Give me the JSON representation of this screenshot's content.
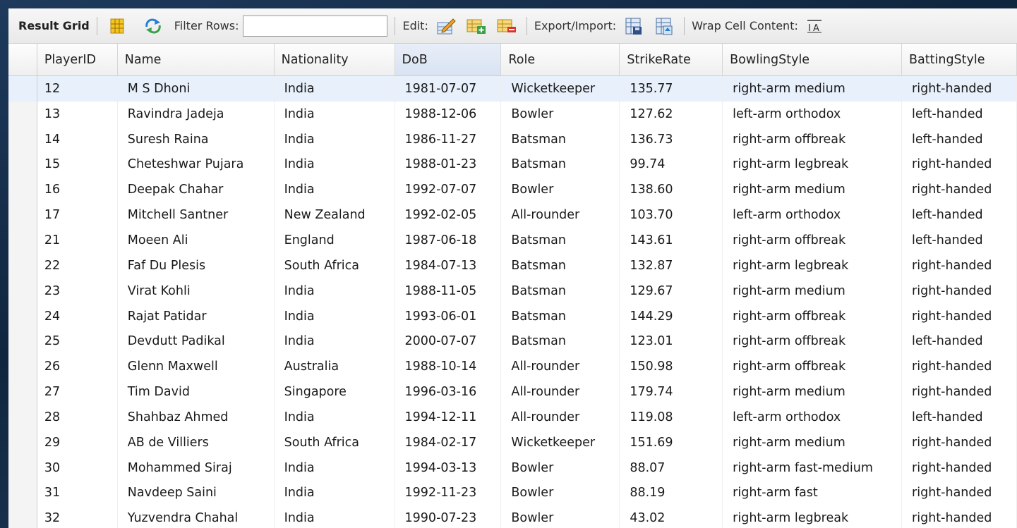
{
  "toolbar": {
    "title": "Result Grid",
    "filter_label": "Filter Rows:",
    "filter_value": "",
    "edit_label": "Edit:",
    "export_label": "Export/Import:",
    "wrap_label": "Wrap Cell Content:",
    "icons": [
      "grid-layout-icon",
      "refresh-icon",
      "edit-row-icon",
      "add-row-icon",
      "delete-row-icon",
      "export-icon",
      "import-icon",
      "wrap-text-icon"
    ]
  },
  "table": {
    "columns": [
      "PlayerID",
      "Name",
      "Nationality",
      "DoB",
      "Role",
      "StrikeRate",
      "BowlingStyle",
      "BattingStyle"
    ],
    "sorted_column": "DoB",
    "rows": [
      [
        "12",
        "M S Dhoni",
        "India",
        "1981-07-07",
        "Wicketkeeper",
        "135.77",
        "right-arm medium",
        "right-handed"
      ],
      [
        "13",
        "Ravindra Jadeja",
        "India",
        "1988-12-06",
        "Bowler",
        "127.62",
        "left-arm orthodox",
        "left-handed"
      ],
      [
        "14",
        "Suresh Raina",
        "India",
        "1986-11-27",
        "Batsman",
        "136.73",
        "right-arm offbreak",
        "left-handed"
      ],
      [
        "15",
        "Cheteshwar Pujara",
        "India",
        "1988-01-23",
        "Batsman",
        "99.74",
        "right-arm legbreak",
        "right-handed"
      ],
      [
        "16",
        "Deepak Chahar",
        "India",
        "1992-07-07",
        "Bowler",
        "138.60",
        "right-arm medium",
        "right-handed"
      ],
      [
        "17",
        "Mitchell Santner",
        "New Zealand",
        "1992-02-05",
        "All-rounder",
        "103.70",
        "left-arm orthodox",
        "left-handed"
      ],
      [
        "21",
        "Moeen Ali",
        "England",
        "1987-06-18",
        "Batsman",
        "143.61",
        "right-arm offbreak",
        "left-handed"
      ],
      [
        "22",
        "Faf Du Plesis",
        "South Africa",
        "1984-07-13",
        "Batsman",
        "132.87",
        "right-arm legbreak",
        "right-handed"
      ],
      [
        "23",
        "Virat Kohli",
        "India",
        "1988-11-05",
        "Batsman",
        "129.67",
        "right-arm medium",
        "right-handed"
      ],
      [
        "24",
        "Rajat Patidar",
        "India",
        "1993-06-01",
        "Batsman",
        "144.29",
        "right-arm offbreak",
        "right-handed"
      ],
      [
        "25",
        "Devdutt Padikal",
        "India",
        "2000-07-07",
        "Batsman",
        "123.01",
        "right-arm offbreak",
        "left-handed"
      ],
      [
        "26",
        "Glenn Maxwell",
        "Australia",
        "1988-10-14",
        "All-rounder",
        "150.98",
        "right-arm offbreak",
        "right-handed"
      ],
      [
        "27",
        "Tim David",
        "Singapore",
        "1996-03-16",
        "All-rounder",
        "179.74",
        "right-arm medium",
        "right-handed"
      ],
      [
        "28",
        "Shahbaz Ahmed",
        "India",
        "1994-12-11",
        "All-rounder",
        "119.08",
        "left-arm orthodox",
        "left-handed"
      ],
      [
        "29",
        "AB de Villiers",
        "South Africa",
        "1984-02-17",
        "Wicketkeeper",
        "151.69",
        "right-arm medium",
        "right-handed"
      ],
      [
        "30",
        "Mohammed Siraj",
        "India",
        "1994-03-13",
        "Bowler",
        "88.07",
        "right-arm fast-medium",
        "right-handed"
      ],
      [
        "31",
        "Navdeep Saini",
        "India",
        "1992-11-23",
        "Bowler",
        "88.19",
        "right-arm fast",
        "right-handed"
      ],
      [
        "32",
        "Yuzvendra Chahal",
        "India",
        "1990-07-23",
        "Bowler",
        "43.02",
        "right-arm legbreak",
        "right-handed"
      ]
    ]
  }
}
